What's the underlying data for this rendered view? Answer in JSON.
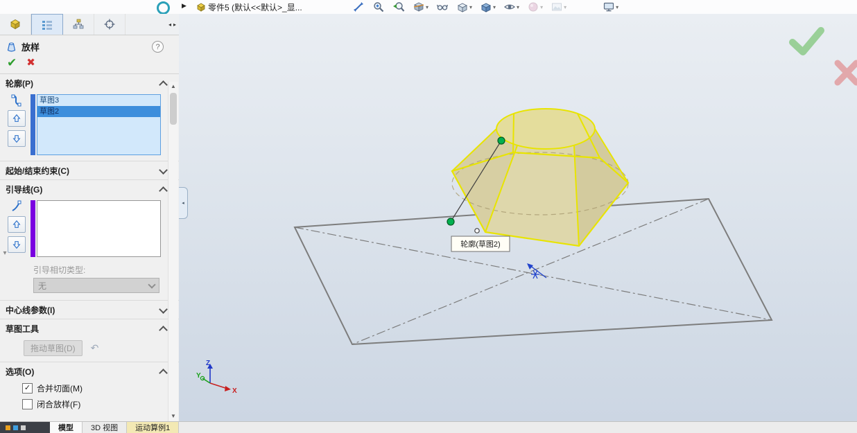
{
  "topbar": {
    "flyout": "▶",
    "part_name": "零件5 (默认<<默认>_显..."
  },
  "panel": {
    "title": "放样",
    "profiles": {
      "header": "轮廓(P)",
      "items": [
        "草图3",
        "草图2"
      ]
    },
    "start_end": {
      "header": "起始/结束约束(C)"
    },
    "guides": {
      "header": "引导线(G)",
      "tangency_label": "引导相切类型:",
      "tangency_value": "无"
    },
    "centerline": {
      "header": "中心线参数(I)"
    },
    "sketch_tools": {
      "header": "草图工具",
      "drag_sketch": "拖动草图(D)"
    },
    "options": {
      "header": "选项(O)",
      "merge_tangent": "合并切面(M)",
      "close_loft": "闭合放样(F)"
    }
  },
  "viewport": {
    "tooltip": "轮廓(草图2)",
    "triad": {
      "x": "X",
      "y": "Y",
      "z": "Z"
    }
  },
  "bottom_tabs": [
    "模型",
    "3D 视图",
    "运动算例1"
  ],
  "colors": {
    "preview_edge_yellow": "#e8e400",
    "selection_blue": "#3d8edc",
    "guide_strip_purple": "#7a00e0",
    "confirm_green": "#59b84f",
    "cancel_red": "#e06868"
  }
}
